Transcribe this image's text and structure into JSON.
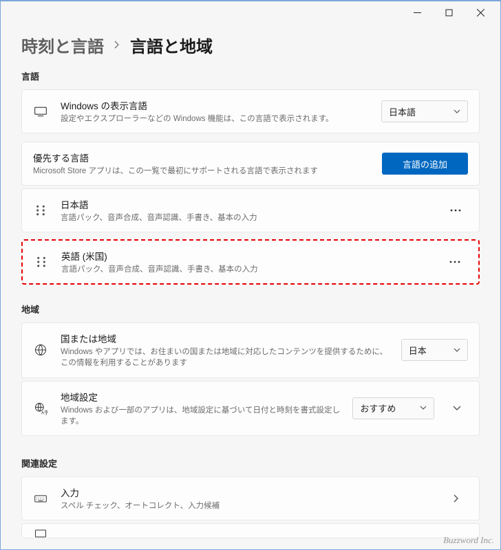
{
  "titlebar": {},
  "breadcrumb": {
    "parent": "時刻と言語",
    "current": "言語と地域"
  },
  "sections": {
    "language_header": "言語",
    "region_header": "地域",
    "related_header": "関連設定"
  },
  "display_language": {
    "title": "Windows の表示言語",
    "sub": "設定やエクスプローラーなどの Windows 機能は、この言語で表示されます。",
    "value": "日本語"
  },
  "preferred_languages": {
    "title": "優先する言語",
    "sub": "Microsoft Store アプリは、この一覧で最初にサポートされる言語で表示されます",
    "add_button": "言語の追加",
    "items": [
      {
        "name": "日本語",
        "features": "言語パック、音声合成、音声認識、手書き、基本の入力"
      },
      {
        "name": "英語 (米国)",
        "features": "言語パック、音声合成、音声認識、手書き、基本の入力"
      }
    ]
  },
  "region": {
    "country": {
      "title": "国または地域",
      "sub": "Windows やアプリでは、お住まいの国または地域に対応したコンテンツを提供するために、この情報を利用することがあります",
      "value": "日本"
    },
    "format": {
      "title": "地域設定",
      "sub": "Windows および一部のアプリは、地域設定に基づいて日付と時刻を書式設定します。",
      "value": "おすすめ"
    }
  },
  "related": {
    "input": {
      "title": "入力",
      "sub": "スペル チェック、オートコレクト、入力候補"
    }
  },
  "watermark": "Buzzword Inc."
}
